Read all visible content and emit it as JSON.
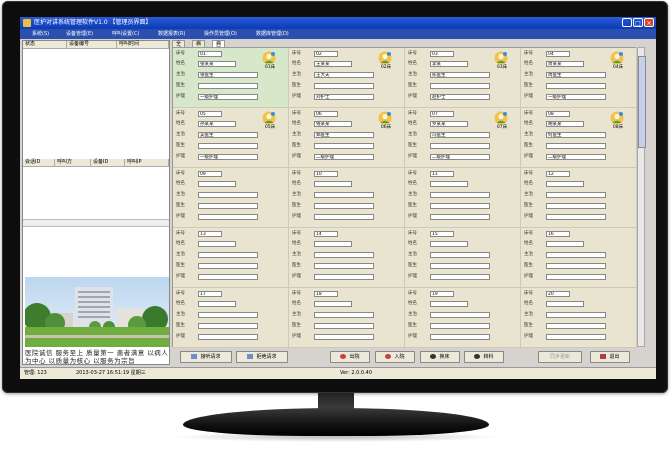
{
  "window": {
    "title": "医护对讲系统管理软件V1.0  【管理员界面】"
  },
  "menu": [
    "系统(S)",
    "设备管理(E)",
    "呼叫设置(C)",
    "数据报表(R)",
    "操作员管理(O)",
    "数据库管理(D)"
  ],
  "left": {
    "top_headers": [
      "状态",
      "设备编号",
      "呼叫时间"
    ],
    "mid_headers": [
      "会话ID",
      "呼叫方",
      "设备ID",
      "呼叫IP"
    ],
    "caption": "医院诚信 服务至上 质量第一 患者满意 以病人为中心 以质量为核心 以服务为宗旨"
  },
  "tabs": [
    "全部",
    "病房",
    "病区"
  ],
  "cards": [
    {
      "num": "01",
      "name": "张某某",
      "doc": "张医生",
      "nurse": "一级护理",
      "pnum": "01床"
    },
    {
      "num": "02",
      "name": "王某某",
      "doc": "王大夫",
      "nurse": "刘护士",
      "pnum": "02床"
    },
    {
      "num": "03",
      "name": "李某",
      "doc": "陈医生",
      "nurse": "赵护士",
      "pnum": "03床"
    },
    {
      "num": "04",
      "name": "周某某",
      "doc": "周医生",
      "nurse": "一级护理",
      "pnum": "04床"
    },
    {
      "num": "05",
      "name": "孙某某",
      "doc": "吴医生",
      "nurse": "一级护理",
      "pnum": "05床"
    },
    {
      "num": "06",
      "name": "钱某某",
      "doc": "郑医生",
      "nurse": "二级护理",
      "pnum": "06床"
    },
    {
      "num": "07",
      "name": "罗某某",
      "doc": "冯医生",
      "nurse": "二级护理",
      "pnum": "07床"
    },
    {
      "num": "08",
      "name": "胡某某",
      "doc": "何医生",
      "nurse": "二级护理",
      "pnum": "08床"
    },
    {
      "num": "09",
      "name": "",
      "doc": "",
      "nurse": "",
      "pnum": ""
    },
    {
      "num": "10",
      "name": "",
      "doc": "",
      "nurse": "",
      "pnum": ""
    },
    {
      "num": "11",
      "name": "",
      "doc": "",
      "nurse": "",
      "pnum": ""
    },
    {
      "num": "12",
      "name": "",
      "doc": "",
      "nurse": "",
      "pnum": ""
    },
    {
      "num": "13",
      "name": "",
      "doc": "",
      "nurse": "",
      "pnum": ""
    },
    {
      "num": "14",
      "name": "",
      "doc": "",
      "nurse": "",
      "pnum": ""
    },
    {
      "num": "15",
      "name": "",
      "doc": "",
      "nurse": "",
      "pnum": ""
    },
    {
      "num": "16",
      "name": "",
      "doc": "",
      "nurse": "",
      "pnum": ""
    },
    {
      "num": "17",
      "name": "",
      "doc": "",
      "nurse": "",
      "pnum": ""
    },
    {
      "num": "18",
      "name": "",
      "doc": "",
      "nurse": "",
      "pnum": ""
    },
    {
      "num": "19",
      "name": "",
      "doc": "",
      "nurse": "",
      "pnum": ""
    },
    {
      "num": "20",
      "name": "",
      "doc": "",
      "nurse": "",
      "pnum": ""
    }
  ],
  "field_labels": [
    "床号",
    "姓名",
    "主治",
    "医生",
    "护理"
  ],
  "buttons": [
    "接听请求",
    "拒绝请求",
    "出院",
    "入院",
    "换床",
    "转科",
    "同步更新",
    "退出"
  ],
  "status": {
    "user": "管理: 123",
    "time": "2013-03-27 16:51:19 星期三",
    "version": "Ver: 2.0.0.40"
  },
  "colors": {
    "titlebar": "#0a3ab4",
    "card": "#e9e4d0",
    "active_card": "#d6e8c9"
  }
}
